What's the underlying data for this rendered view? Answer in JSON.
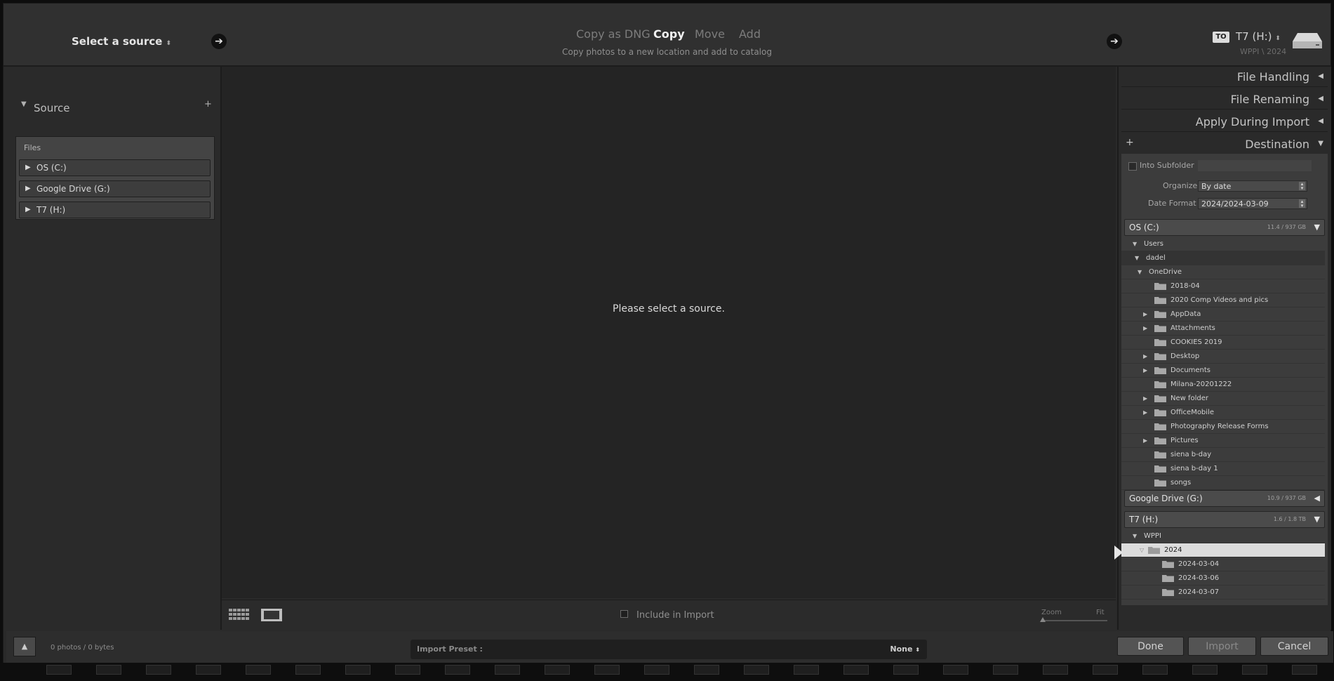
{
  "top": {
    "select_source": "Select a source",
    "modes": [
      "Copy as DNG",
      "Copy",
      "Move",
      "Add"
    ],
    "active_mode": "Copy",
    "mode_subtitle": "Copy photos to a new location and add to catalog",
    "to_badge": "TO",
    "to_drive": "T7 (H:)",
    "to_path": "WPPI \\ 2024"
  },
  "left": {
    "source_heading": "Source",
    "files_label": "Files",
    "volumes": [
      "OS (C:)",
      "Google Drive (G:)",
      "T7 (H:)"
    ]
  },
  "center": {
    "message": "Please select a source.",
    "include_label": "Include in Import",
    "zoom_label": "Zoom",
    "fit_label": "Fit"
  },
  "right": {
    "sections": [
      "File Handling",
      "File Renaming",
      "Apply During Import",
      "Destination"
    ],
    "into_subfolder": "Into Subfolder",
    "organize_label": "Organize",
    "organize_value": "By date",
    "date_format_label": "Date Format",
    "date_format_value": "2024/2024-03-09",
    "drive_c": {
      "name": "OS (C:)",
      "size": "11.4 / 937 GB"
    },
    "tree_c": {
      "users": "Users",
      "dadel": "dadel",
      "onedrive": "OneDrive",
      "folders": [
        {
          "name": "2018-04",
          "expand": false
        },
        {
          "name": "2020 Comp Videos and pics",
          "expand": false
        },
        {
          "name": "AppData",
          "expand": true
        },
        {
          "name": "Attachments",
          "expand": true
        },
        {
          "name": "COOKIES 2019",
          "expand": false
        },
        {
          "name": "Desktop",
          "expand": true
        },
        {
          "name": "Documents",
          "expand": true
        },
        {
          "name": "Milana-20201222",
          "expand": false
        },
        {
          "name": "New folder",
          "expand": true
        },
        {
          "name": "OfficeMobile",
          "expand": true
        },
        {
          "name": "Photography Release Forms",
          "expand": false
        },
        {
          "name": "Pictures",
          "expand": true
        },
        {
          "name": "siena b-day",
          "expand": false
        },
        {
          "name": "siena b-day 1",
          "expand": false
        },
        {
          "name": "songs",
          "expand": false
        }
      ]
    },
    "drive_g": {
      "name": "Google Drive (G:)",
      "size": "10.9 / 937 GB"
    },
    "drive_h": {
      "name": "T7 (H:)",
      "size": "1.6 / 1.8 TB"
    },
    "tree_h": {
      "wppi": "WPPI",
      "year": "2024",
      "dates": [
        "2024-03-04",
        "2024-03-06",
        "2024-03-07"
      ]
    }
  },
  "bottom": {
    "count": "0 photos / 0 bytes",
    "preset_label": "Import Preset :",
    "preset_value": "None",
    "done": "Done",
    "import": "Import",
    "cancel": "Cancel"
  },
  "colors": {
    "window_bg": "#2a2a2a",
    "center_bg": "#242424",
    "highlight_row": "#dcdcdc"
  }
}
